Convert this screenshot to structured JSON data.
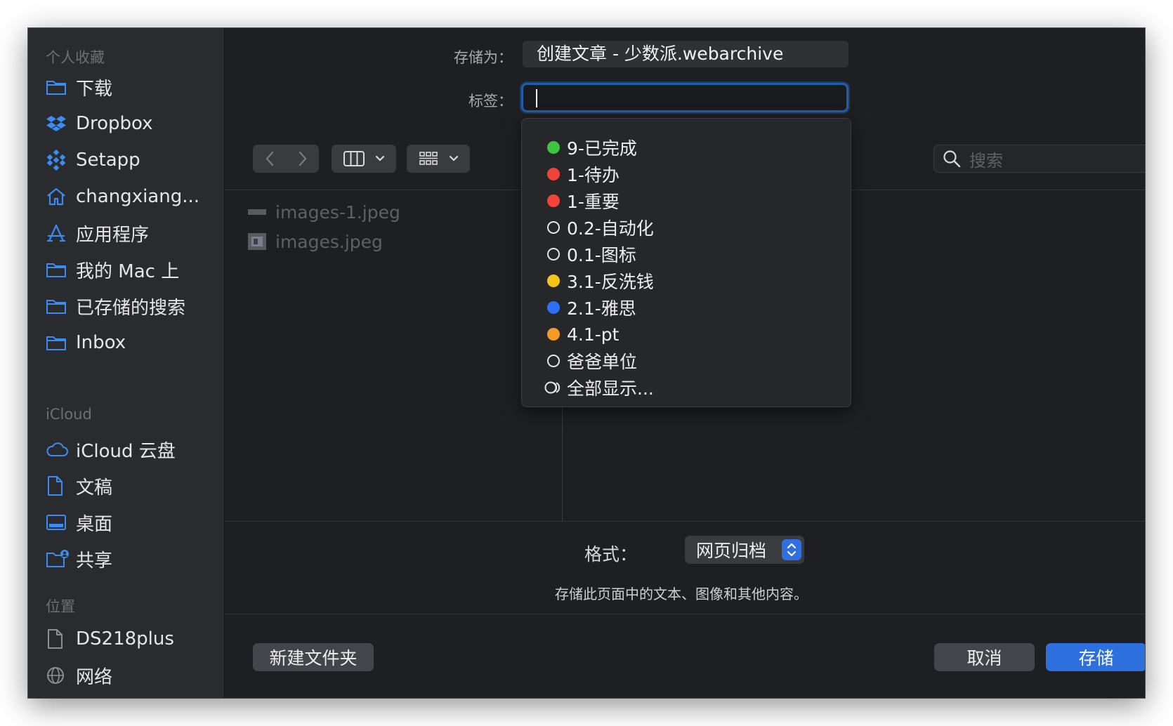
{
  "sidebar": {
    "sections": {
      "favorites": "个人收藏",
      "icloud": "iCloud",
      "locations": "位置"
    },
    "favorites": [
      {
        "label": "下载",
        "icon": "folder-icon"
      },
      {
        "label": "Dropbox",
        "icon": "dropbox-icon"
      },
      {
        "label": "Setapp",
        "icon": "setapp-icon"
      },
      {
        "label": "changxiang...",
        "icon": "home-icon"
      },
      {
        "label": "应用程序",
        "icon": "applications-icon"
      },
      {
        "label": "我的 Mac 上",
        "icon": "folder-icon"
      },
      {
        "label": "已存储的搜索",
        "icon": "folder-icon"
      },
      {
        "label": "Inbox",
        "icon": "folder-icon"
      }
    ],
    "icloud": [
      {
        "label": "iCloud 云盘",
        "icon": "cloud-icon"
      },
      {
        "label": "文稿",
        "icon": "document-icon"
      },
      {
        "label": "桌面",
        "icon": "desktop-icon"
      },
      {
        "label": "共享",
        "icon": "shared-folder-icon"
      }
    ],
    "locations": [
      {
        "label": "DS218plus",
        "icon": "document-icon"
      },
      {
        "label": "网络",
        "icon": "network-icon"
      }
    ]
  },
  "save_as": {
    "label": "存储为：",
    "value": "创建文章 - 少数派.webarchive"
  },
  "tags": {
    "label": "标签：",
    "value": ""
  },
  "search": {
    "placeholder": "搜索"
  },
  "files": [
    {
      "name": "images-1.jpeg"
    },
    {
      "name": "images.jpeg"
    }
  ],
  "tag_options": [
    {
      "label": "9-已完成",
      "color": "#3fc43f"
    },
    {
      "label": "1-待办",
      "color": "#f2443b"
    },
    {
      "label": "1-重要",
      "color": "#f2443b"
    },
    {
      "label": "0.2-自动化",
      "color": ""
    },
    {
      "label": "0.1-图标",
      "color": ""
    },
    {
      "label": "3.1-反洗钱",
      "color": "#f5c51b"
    },
    {
      "label": "2.1-雅思",
      "color": "#2f6ff5"
    },
    {
      "label": "4.1-pt",
      "color": "#f59a23"
    },
    {
      "label": "爸爸单位",
      "color": ""
    },
    {
      "label": "全部显示...",
      "color": ""
    }
  ],
  "format": {
    "label": "格式：",
    "value": "网页归档",
    "description": "存储此页面中的文本、图像和其他内容。"
  },
  "buttons": {
    "new_folder": "新建文件夹",
    "cancel": "取消",
    "save": "存储"
  },
  "colors": {
    "accent": "#2d6fdc",
    "background": "#1e1f23",
    "sidebar": "#2a2b2f"
  }
}
